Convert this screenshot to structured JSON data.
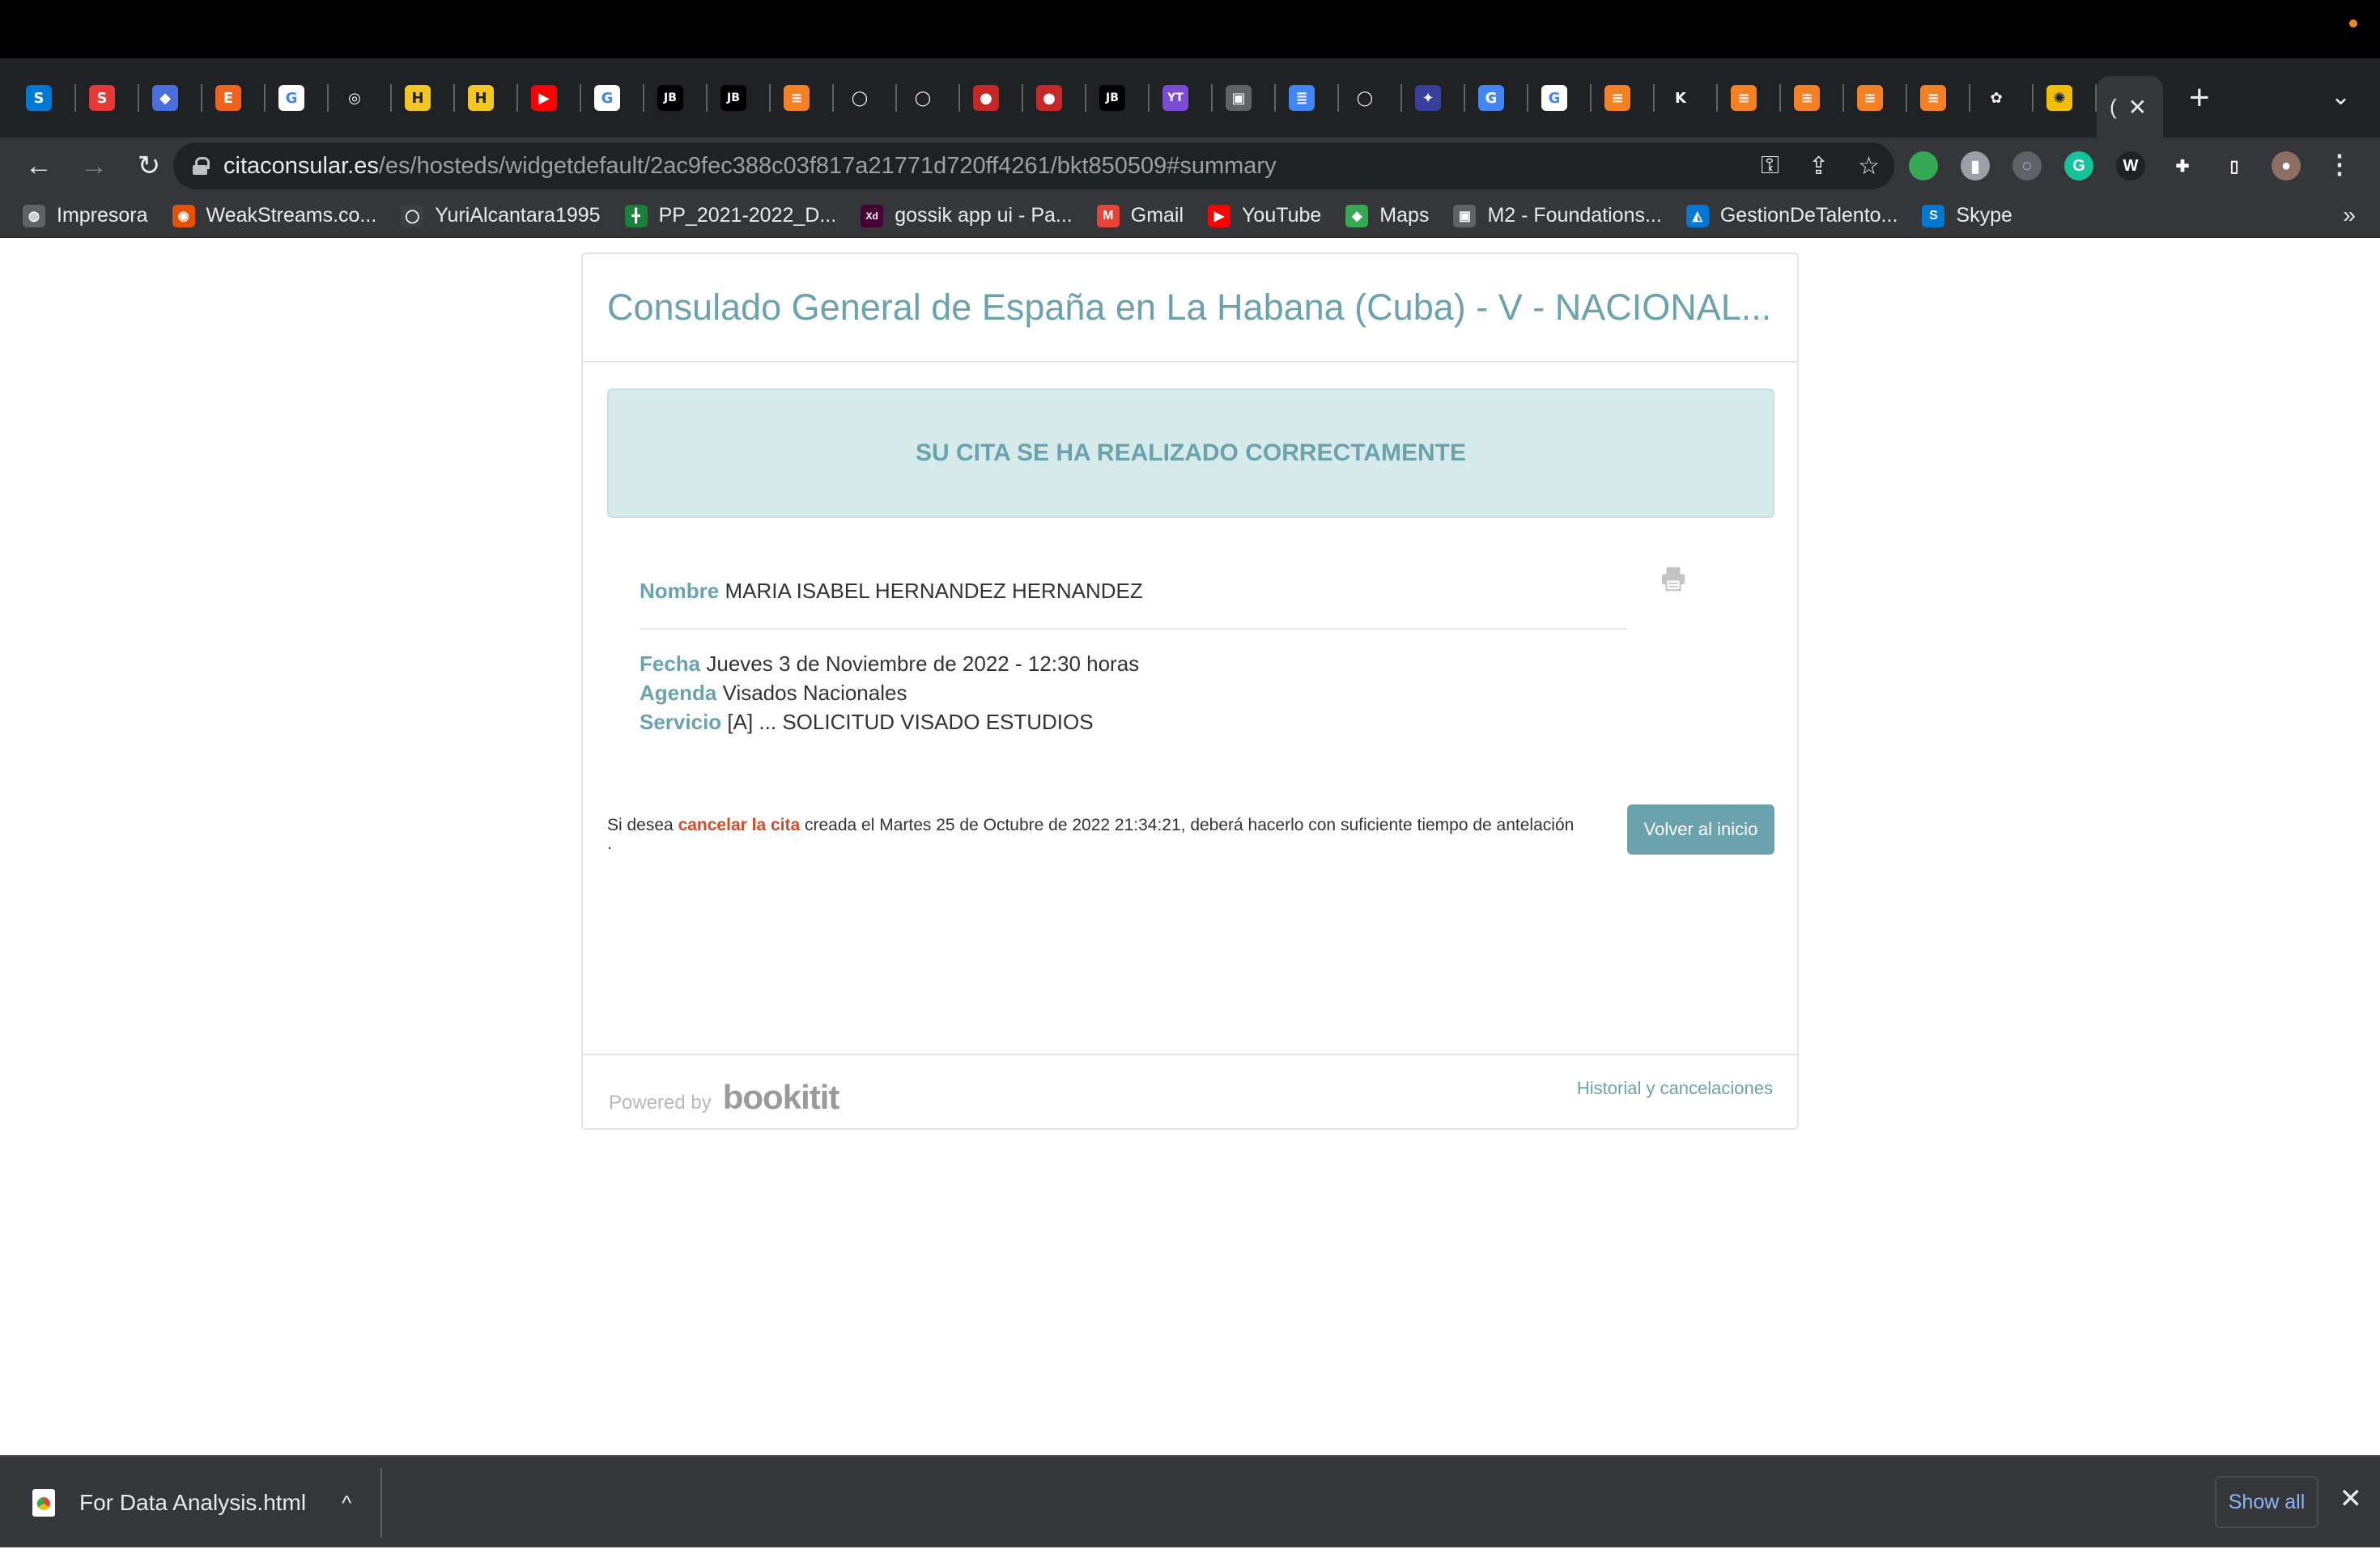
{
  "browser": {
    "tabs": [
      {
        "icon": "skype-icon",
        "glyph": "S",
        "color": "#0078d4"
      },
      {
        "icon": "s-app-icon",
        "glyph": "S",
        "color": "#e53935"
      },
      {
        "icon": "diamond-icon",
        "glyph": "◆",
        "color": "#4a6fdc"
      },
      {
        "icon": "etsy-icon",
        "glyph": "E",
        "color": "#f1641e"
      },
      {
        "icon": "google-icon",
        "glyph": "G",
        "color": "#ffffff"
      },
      {
        "icon": "compass-icon",
        "glyph": "◎",
        "color": "#202124"
      },
      {
        "icon": "hbo-icon",
        "glyph": "H",
        "color": "#f3c623"
      },
      {
        "icon": "hbo-icon",
        "glyph": "H",
        "color": "#f3c623"
      },
      {
        "icon": "youtube-icon",
        "glyph": "▶",
        "color": "#ff0000"
      },
      {
        "icon": "google-icon",
        "glyph": "G",
        "color": "#ffffff"
      },
      {
        "icon": "jetbrains-icon",
        "glyph": "JB",
        "color": "#000000"
      },
      {
        "icon": "jetbrains-icon",
        "glyph": "JB",
        "color": "#000000"
      },
      {
        "icon": "stackoverflow-icon",
        "glyph": "≡",
        "color": "#f48024"
      },
      {
        "icon": "github-icon",
        "glyph": "◯",
        "color": "#202124"
      },
      {
        "icon": "github-icon",
        "glyph": "◯",
        "color": "#202124"
      },
      {
        "icon": "record-icon",
        "glyph": "●",
        "color": "#c62828"
      },
      {
        "icon": "record-icon",
        "glyph": "●",
        "color": "#c62828"
      },
      {
        "icon": "jetbrains-icon",
        "glyph": "JB",
        "color": "#000000"
      },
      {
        "icon": "youtrack-icon",
        "glyph": "YT",
        "color": "#7b4bd6"
      },
      {
        "icon": "contact-icon",
        "glyph": "▣",
        "color": "#5f6368"
      },
      {
        "icon": "docs-icon",
        "glyph": "≣",
        "color": "#4285f4"
      },
      {
        "icon": "github-icon",
        "glyph": "◯",
        "color": "#202124"
      },
      {
        "icon": "puzzle-board-icon",
        "glyph": "✦",
        "color": "#3a3f9e"
      },
      {
        "icon": "translate-icon",
        "glyph": "G",
        "color": "#4285f4"
      },
      {
        "icon": "google-icon",
        "glyph": "G",
        "color": "#ffffff"
      },
      {
        "icon": "stackoverflow-icon",
        "glyph": "≡",
        "color": "#f48024"
      },
      {
        "icon": "k-icon",
        "glyph": "K",
        "color": "#202124"
      },
      {
        "icon": "stackoverflow-icon",
        "glyph": "≡",
        "color": "#f48024"
      },
      {
        "icon": "stackoverflow-icon",
        "glyph": "≡",
        "color": "#f48024"
      },
      {
        "icon": "stackoverflow-icon",
        "glyph": "≡",
        "color": "#f48024"
      },
      {
        "icon": "stackoverflow-icon",
        "glyph": "≡",
        "color": "#f48024"
      },
      {
        "icon": "openai-icon",
        "glyph": "✿",
        "color": "#202124"
      },
      {
        "icon": "spain-flag-icon",
        "glyph": "✺",
        "color": "#f1bf00"
      }
    ],
    "active_tab": {
      "glyph": "(",
      "close": "✕"
    },
    "new_tab": "+",
    "tab_menu": "⌄",
    "address": {
      "host": "citaconsular.es",
      "path": "/es/hosteds/widgetdefault/2ac9fec388c03f817a21771d720ff4261/bkt850509#summary"
    },
    "extensions": [
      {
        "icon": "green-dot-extension-icon",
        "glyph": "",
        "color": "#34a853"
      },
      {
        "icon": "chart-extension-icon",
        "glyph": "▮",
        "color": "#9aa0a6"
      },
      {
        "icon": "sync-extension-icon",
        "glyph": "◌",
        "color": "#5f6368"
      },
      {
        "icon": "grammarly-extension-icon",
        "glyph": "G",
        "color": "#15c39a"
      },
      {
        "icon": "w-extension-icon",
        "glyph": "W",
        "color": "#202124"
      },
      {
        "icon": "puzzle-extensions-icon",
        "glyph": "✚",
        "color": "#35363a"
      },
      {
        "icon": "sidepanel-icon",
        "glyph": "▯",
        "color": "#35363a"
      },
      {
        "icon": "profile-avatar-icon",
        "glyph": "●",
        "color": "#8d6e63"
      }
    ],
    "bookmarks": [
      {
        "label": "Impresora",
        "icon": "globe-icon",
        "glyph": "◍",
        "color": "#5f6368"
      },
      {
        "label": "WeakStreams.co...",
        "icon": "weakstreams-icon",
        "glyph": "◉",
        "color": "#e65100"
      },
      {
        "label": "YuriAlcantara1995",
        "icon": "github-icon",
        "glyph": "◯",
        "color": "#3c4043"
      },
      {
        "label": "PP_2021-2022_D...",
        "icon": "sheets-icon",
        "glyph": "╋",
        "color": "#188038"
      },
      {
        "label": "gossik app ui - Pa...",
        "icon": "xd-icon",
        "glyph": "Xd",
        "color": "#470137"
      },
      {
        "label": "Gmail",
        "icon": "gmail-icon",
        "glyph": "M",
        "color": "#ea4335"
      },
      {
        "label": "YouTube",
        "icon": "youtube-icon",
        "glyph": "▶",
        "color": "#ff0000"
      },
      {
        "label": "Maps",
        "icon": "maps-icon",
        "glyph": "◆",
        "color": "#34a853"
      },
      {
        "label": "M2 - Foundations...",
        "icon": "contact-icon",
        "glyph": "▣",
        "color": "#5f6368"
      },
      {
        "label": "GestionDeTalento...",
        "icon": "azure-icon",
        "glyph": "◭",
        "color": "#0078d4"
      },
      {
        "label": "Skype",
        "icon": "skype-icon",
        "glyph": "S",
        "color": "#0078d4"
      }
    ],
    "bookmarks_more": "»"
  },
  "widget": {
    "title": "Consulado General de España en La Habana (Cuba) - V - NACIONAL...",
    "success_message": "SU CITA SE HA REALIZADO CORRECTAMENTE",
    "details": {
      "nombre_label": "Nombre",
      "nombre_value": "MARIA ISABEL HERNANDEZ HERNANDEZ",
      "fecha_label": "Fecha",
      "fecha_value": "Jueves 3 de Noviembre de 2022 - 12:30 horas",
      "agenda_label": "Agenda",
      "agenda_value": "Visados Nacionales",
      "servicio_label": "Servicio",
      "servicio_value": "[A] ... SOLICITUD VISADO ESTUDIOS"
    },
    "note": {
      "before": "Si desea ",
      "link": "cancelar la cita",
      "after": " creada el Martes 25 de Octubre de 2022 21:34:21, deberá hacerlo con suficiente tiempo de antelación ."
    },
    "volver_button": "Volver al inicio",
    "powered_by": "Powered by",
    "brand": "bookitit",
    "historial_link": "Historial y cancelaciones"
  },
  "download_bar": {
    "file_name": "For Data Analysis.html",
    "chevron": "^",
    "show_all": "Show all",
    "close": "✕"
  }
}
